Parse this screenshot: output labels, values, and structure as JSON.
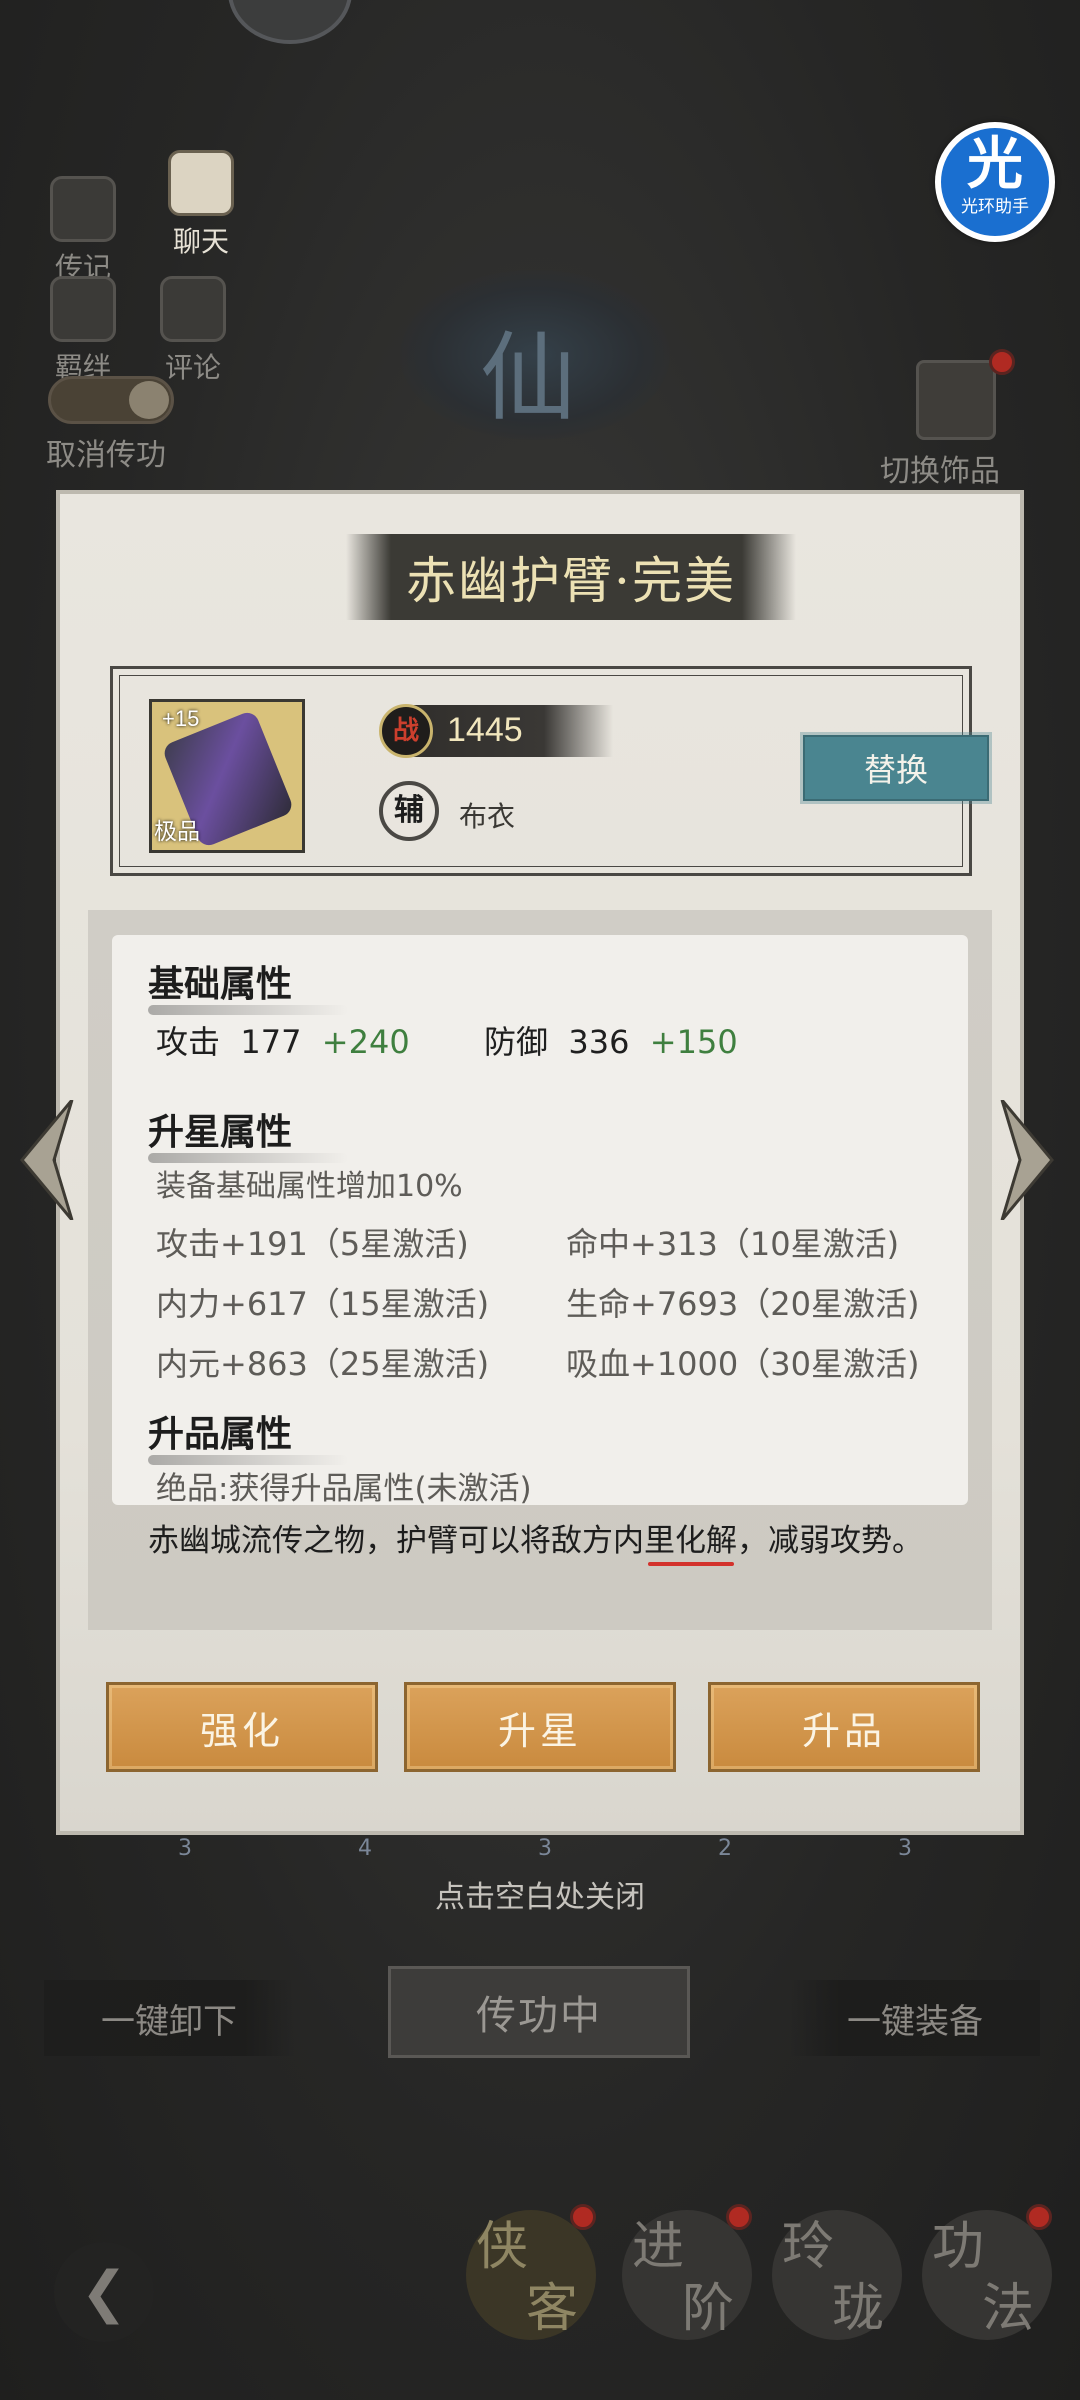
{
  "background": {
    "side_buttons": [
      {
        "label": "传记",
        "icon": "book-icon"
      },
      {
        "label": "聊天",
        "icon": "chat-bubble-icon"
      },
      {
        "label": "羁绊",
        "icon": "portrait-icon"
      },
      {
        "label": "评论",
        "icon": "pencil-icon"
      }
    ],
    "toggle_label": "取消传功",
    "sect_emblem": "仙",
    "switch_accessory_label": "切换饰品",
    "assistant_badge": {
      "big": "光",
      "small": "光环助手"
    },
    "close_hint": "点击空白处关闭",
    "hex_levels": [
      "3",
      "4",
      "3",
      "2",
      "3"
    ],
    "bottom_left": "一键卸下",
    "bottom_center": "传功中",
    "bottom_right": "一键装备",
    "bottom_tabs": [
      {
        "chars": [
          "侠",
          "客"
        ]
      },
      {
        "chars": [
          "进",
          "阶"
        ]
      },
      {
        "chars": [
          "玲",
          "珑"
        ]
      },
      {
        "chars": [
          "功",
          "法"
        ]
      }
    ]
  },
  "modal": {
    "title": "赤幽护臂·完美",
    "item": {
      "enhance_level": "+15",
      "grade": "极品",
      "power_icon": "战",
      "power": "1445",
      "set_icon": "辅",
      "set_name": "布衣"
    },
    "replace_button": "替换",
    "base_attr": {
      "title": "基础属性",
      "attack_label": "攻击",
      "attack_value": "177",
      "attack_bonus": "+240",
      "defense_label": "防御",
      "defense_value": "336",
      "defense_bonus": "+150"
    },
    "star_attr": {
      "title": "升星属性",
      "summary": "装备基础属性增加10%",
      "rows": [
        [
          "攻击+191（5星激活)",
          "命中+313（10星激活)"
        ],
        [
          "内力+617（15星激活)",
          "生命+7693（20星激活)"
        ],
        [
          "内元+863（25星激活)",
          "吸血+1000（30星激活)"
        ]
      ]
    },
    "grade_attr": {
      "title": "升品属性",
      "text": "绝品:获得升品属性(未激活)"
    },
    "description": "赤幽城流传之物，护臂可以将敌方内里化解，减弱攻势。",
    "buttons": [
      "强化",
      "升星",
      "升品"
    ]
  }
}
